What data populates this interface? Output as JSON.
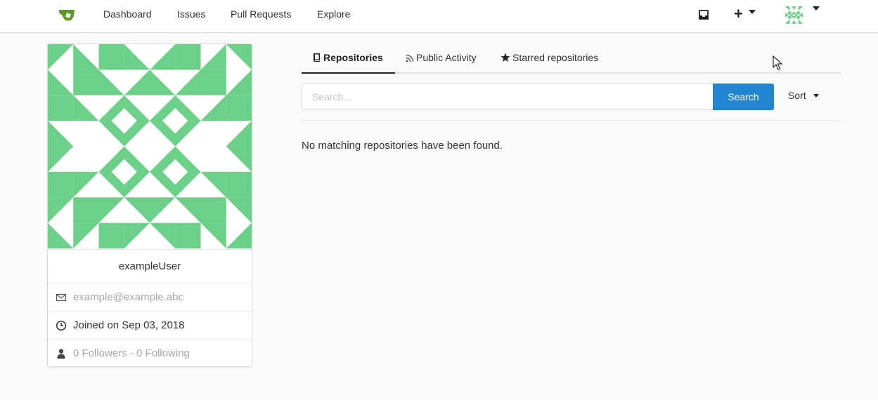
{
  "nav": {
    "items": [
      {
        "label": "Dashboard"
      },
      {
        "label": "Issues"
      },
      {
        "label": "Pull Requests"
      },
      {
        "label": "Explore"
      }
    ],
    "icons": {
      "logo": "gitea-teapot-icon",
      "inbox": "inbox-icon",
      "create": "plus-icon",
      "user": "avatar"
    },
    "plus_label": "+"
  },
  "profile": {
    "username": "exampleUser",
    "email": "example@example.abc",
    "joined": "Joined on Sep 03, 2018",
    "followers": "0 Followers - 0 Following"
  },
  "tabs": [
    {
      "label": "Repositories",
      "icon": "book-icon",
      "active": true
    },
    {
      "label": "Public Activity",
      "icon": "rss-icon",
      "active": false
    },
    {
      "label": "Starred repositories",
      "icon": "star-icon",
      "active": false
    }
  ],
  "search": {
    "placeholder": "Search...",
    "value": "",
    "button_label": "Search",
    "sort_label": "Sort"
  },
  "results": {
    "empty_message": "No matching repositories have been found."
  },
  "colors": {
    "accent": "#2185d0",
    "avatar_green": "#6cd088",
    "logo_green": "#609926"
  }
}
